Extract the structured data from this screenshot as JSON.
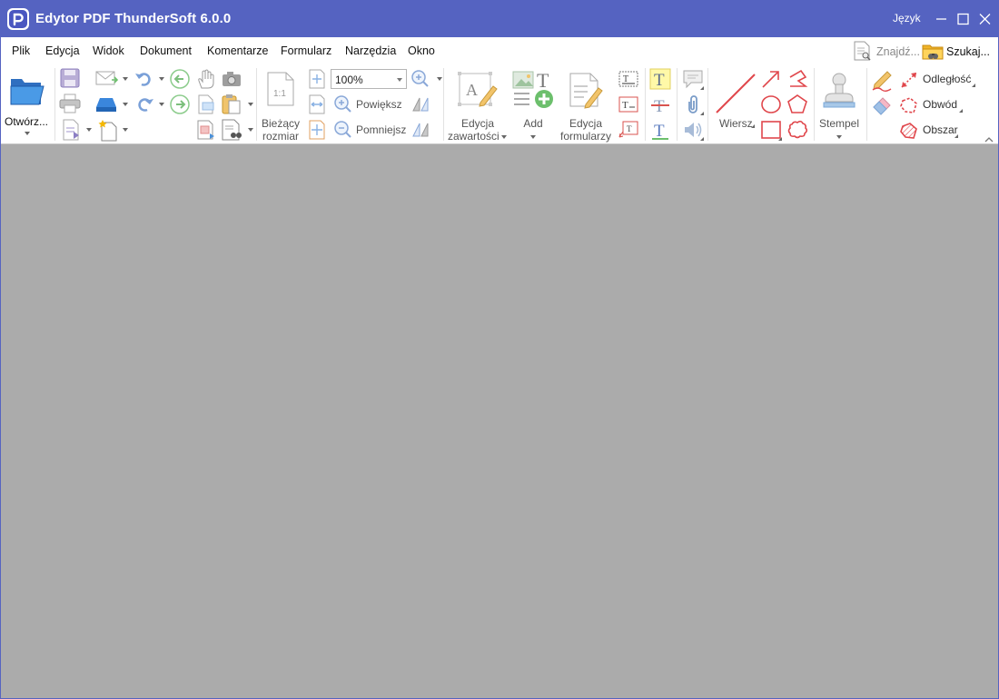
{
  "window": {
    "title": "Edytor PDF ThunderSoft 6.0.0",
    "language_label": "Język"
  },
  "menu": [
    {
      "label": "Plik"
    },
    {
      "label": "Edycja"
    },
    {
      "label": "Widok"
    },
    {
      "label": "Dokument"
    },
    {
      "label": "Komentarze"
    },
    {
      "label": "Formularz"
    },
    {
      "label": "Narzędzia"
    },
    {
      "label": "Okno"
    }
  ],
  "top_tools": {
    "find_label": "Znajdź...",
    "search_label": "Szukaj..."
  },
  "ribbon": {
    "open_label": "Otwórz...",
    "current_size_label_1": "Bieżący",
    "current_size_label_2": "rozmiar",
    "zoom_value": "100%",
    "zoom_in_label": "Powiększ",
    "zoom_out_label": "Pomniejsz",
    "edit_content_label_1": "Edycja",
    "edit_content_label_2": "zawartości",
    "add_label": "Add",
    "edit_forms_label_1": "Edycja",
    "edit_forms_label_2": "formularzy",
    "line_label": "Wiersz",
    "stamp_label": "Stempel",
    "distance_label": "Odległość",
    "perimeter_label": "Obwód",
    "area_label": "Obszar"
  },
  "colors": {
    "titlebar": "#5563c1",
    "document_background": "#ababab",
    "annotation_red": "#e0474c",
    "toolbar_blue": "#3b7fd4"
  }
}
